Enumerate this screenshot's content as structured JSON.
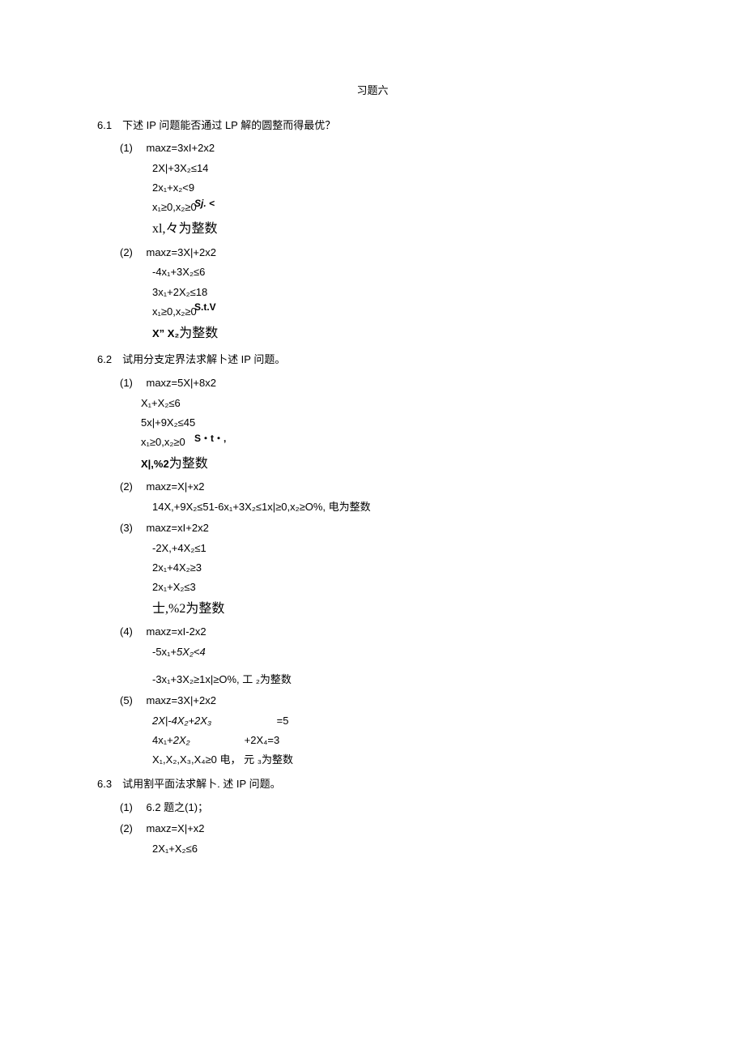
{
  "title": "习题六",
  "q61": {
    "heading": "6.1　下述 IP 问题能否通过 LP 解的圆整而得最优？",
    "p1": {
      "label": "(1)　 maxz=3xI+2x2",
      "c1": "2X|+3X₂≤14",
      "c2": "2x₁+x₂<9",
      "st": "Sj. <",
      "c3": "x₁≥0,x₂≥0",
      "c4": "xl,々为整数"
    },
    "p2": {
      "label": "(2)　 maxz=3X|+2x2",
      "c1": "-4x₁+3X₂≤6",
      "c2": "3x₁+2X₂≤18",
      "st": "S.t.V",
      "c3": "x₁≥0,x₂≥0",
      "c4_pre": "X” X₂",
      "c4_post": "为整数"
    }
  },
  "q62": {
    "heading": "6.2　试用分支定界法求解卜述 IP 问题。",
    "p1": {
      "label": "(1)　 maxz=5X|+8x2",
      "c1": "X₁+X₂≤6",
      "c2": "5x|+9X₂≤45",
      "st": "S・t・,",
      "c3": "x₁≥0,x₂≥0",
      "c4_pre": "X|,%2",
      "c4_post": "为整数"
    },
    "p2": {
      "label": "(2)　 maxz=X|+x2",
      "c1": "14X,+9X₂≤51-6x₁+3X₂≤1x|≥0,x₂≥O%, 电为整数"
    },
    "p3": {
      "label": "(3)　 maxz=xI+2x2",
      "c1": "-2X,+4X₂≤1",
      "c2": "2x₁+4X₂≥3",
      "c3": "2x₁+X₂≤3",
      "c4": "士,%2为整数"
    },
    "p4": {
      "label": "(4)　 maxz=xI-2x2",
      "c1": "-5x₁+5X₂<4",
      "c2": "-3x₁+3X₂≥1x|≥O%, 工 ₂为整数"
    },
    "p5": {
      "label": "(5)　 maxz=3X|+2x2",
      "c1a": "2X|-4X₂+2X₃",
      "c1b": "=5",
      "c2a": "4x₁+2X₂",
      "c2b": "+2X₄=3",
      "c3": "X₁,X₂,X₃,X₄≥0 电， 元 ₃为整数"
    }
  },
  "q63": {
    "heading": "6.3　试用割平面法求解卜. 述 IP 问题。",
    "p1": "(1)　 6.2 题之(1)；",
    "p2": {
      "label": "(2)　 maxz=X|+x2",
      "c1": "2X₁+X₂≤6"
    }
  }
}
